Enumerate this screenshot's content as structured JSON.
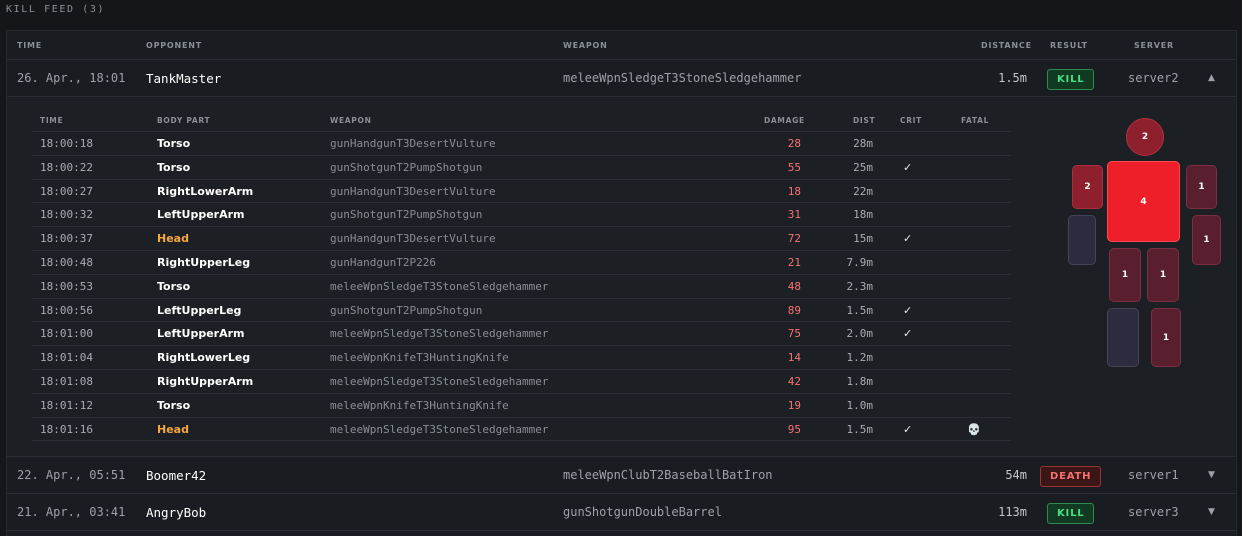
{
  "header": {
    "title": "KILL FEED (3)"
  },
  "columns": {
    "time": "TIME",
    "opponent": "OPPONENT",
    "weapon": "WEAPON",
    "distance": "DISTANCE",
    "result": "RESULT",
    "server": "SERVER"
  },
  "rows": [
    {
      "time": "26. Apr., 18:01",
      "opponent": "TankMaster",
      "weapon": "meleeWpnSledgeT3StoneSledgehammer",
      "distance": "1.5m",
      "result": "KILL",
      "server": "server2",
      "chevron": "▲"
    },
    {
      "time": "22. Apr., 05:51",
      "opponent": "Boomer42",
      "weapon": "meleeWpnClubT2BaseballBatIron",
      "distance": "54m",
      "result": "DEATH",
      "server": "server1",
      "chevron": "▼"
    },
    {
      "time": "21. Apr., 03:41",
      "opponent": "AngryBob",
      "weapon": "gunShotgunDoubleBarrel",
      "distance": "113m",
      "result": "KILL",
      "server": "server3",
      "chevron": "▼"
    }
  ],
  "detail": {
    "columns": {
      "time": "TIME",
      "body_part": "BODY PART",
      "weapon": "WEAPON",
      "damage": "DAMAGE",
      "dist": "DIST",
      "crit": "CRIT",
      "fatal": "FATAL"
    },
    "hits": [
      {
        "time": "18:00:18",
        "part": "Torso",
        "weapon": "gunHandgunT3DesertVulture",
        "damage": "28",
        "dist": "28m",
        "crit": "",
        "fatal": ""
      },
      {
        "time": "18:00:22",
        "part": "Torso",
        "weapon": "gunShotgunT2PumpShotgun",
        "damage": "55",
        "dist": "25m",
        "crit": "✓",
        "fatal": ""
      },
      {
        "time": "18:00:27",
        "part": "RightLowerArm",
        "weapon": "gunHandgunT3DesertVulture",
        "damage": "18",
        "dist": "22m",
        "crit": "",
        "fatal": ""
      },
      {
        "time": "18:00:32",
        "part": "LeftUpperArm",
        "weapon": "gunShotgunT2PumpShotgun",
        "damage": "31",
        "dist": "18m",
        "crit": "",
        "fatal": ""
      },
      {
        "time": "18:00:37",
        "part": "Head",
        "weapon": "gunHandgunT3DesertVulture",
        "damage": "72",
        "dist": "15m",
        "crit": "✓",
        "fatal": ""
      },
      {
        "time": "18:00:48",
        "part": "RightUpperLeg",
        "weapon": "gunHandgunT2P226",
        "damage": "21",
        "dist": "7.9m",
        "crit": "",
        "fatal": ""
      },
      {
        "time": "18:00:53",
        "part": "Torso",
        "weapon": "meleeWpnSledgeT3StoneSledgehammer",
        "damage": "48",
        "dist": "2.3m",
        "crit": "",
        "fatal": ""
      },
      {
        "time": "18:00:56",
        "part": "LeftUpperLeg",
        "weapon": "gunShotgunT2PumpShotgun",
        "damage": "89",
        "dist": "1.5m",
        "crit": "✓",
        "fatal": ""
      },
      {
        "time": "18:01:00",
        "part": "LeftUpperArm",
        "weapon": "meleeWpnSledgeT3StoneSledgehammer",
        "damage": "75",
        "dist": "2.0m",
        "crit": "✓",
        "fatal": ""
      },
      {
        "time": "18:01:04",
        "part": "RightLowerLeg",
        "weapon": "meleeWpnKnifeT3HuntingKnife",
        "damage": "14",
        "dist": "1.2m",
        "crit": "",
        "fatal": ""
      },
      {
        "time": "18:01:08",
        "part": "RightUpperArm",
        "weapon": "meleeWpnSledgeT3StoneSledgehammer",
        "damage": "42",
        "dist": "1.8m",
        "crit": "",
        "fatal": ""
      },
      {
        "time": "18:01:12",
        "part": "Torso",
        "weapon": "meleeWpnKnifeT3HuntingKnife",
        "damage": "19",
        "dist": "1.0m",
        "crit": "",
        "fatal": ""
      },
      {
        "time": "18:01:16",
        "part": "Head",
        "weapon": "meleeWpnSledgeT3StoneSledgehammer",
        "damage": "95",
        "dist": "1.5m",
        "crit": "✓",
        "fatal": "💀"
      }
    ],
    "body_map": {
      "head": "2",
      "torso": "4",
      "left_upper_arm": "2",
      "right_upper_arm": "1",
      "left_lower_arm": "",
      "right_lower_arm": "1",
      "left_upper_leg": "1",
      "right_upper_leg": "1",
      "left_lower_leg": "",
      "right_lower_leg": "1"
    }
  },
  "colors": {
    "kill": "#4ade80",
    "death": "#f87171",
    "head_hit": "#f5a742",
    "damage": "#f87171",
    "torso_heat": "#ef1f2a",
    "high_heat": "#8e1f2c",
    "low_heat": "#5a1f2e",
    "no_hits": "#2d2c3e"
  }
}
